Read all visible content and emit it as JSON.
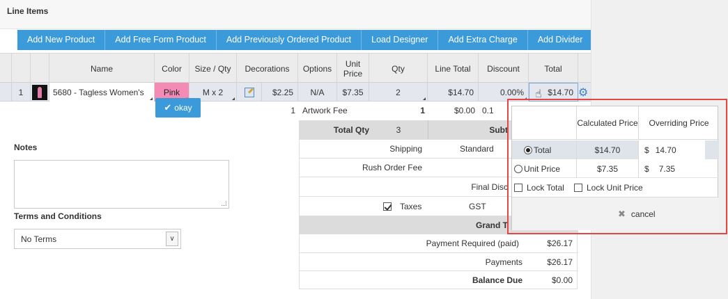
{
  "section_title": "Line Items",
  "toolbar": {
    "buttons": [
      "Add New Product",
      "Add Free Form Product",
      "Add Previously Ordered Product",
      "Load Designer",
      "Add Extra Charge",
      "Add Divider"
    ]
  },
  "table": {
    "headers": {
      "name": "Name",
      "color": "Color",
      "size_qty": "Size / Qty",
      "decorations": "Decorations",
      "options": "Options",
      "unit_price": "Unit Price",
      "qty": "Qty",
      "line_total": "Line Total",
      "discount": "Discount",
      "total": "Total"
    },
    "row1": {
      "index": "1",
      "name": "5680 - Tagless Women's",
      "color": "Pink",
      "size_qty": "M x 2",
      "decorations": "$2.25",
      "options": "N/A",
      "unit_price": "$7.35",
      "qty": "2",
      "line_total": "$14.70",
      "discount": "0.00%",
      "total": "$14.70"
    },
    "row2": {
      "index": "1",
      "name": "Artwork Fee",
      "qty": "1",
      "line_total": "$0.00",
      "discount": "0.1"
    }
  },
  "summary": {
    "total_qty_label": "Total Qty",
    "total_qty_value": "3",
    "subtotal_label": "Subt",
    "shipping_label": "Shipping",
    "shipping_method": "Standard",
    "rush_label": "Rush Order Fee",
    "final_disc_label": "Final Disc",
    "taxes_label": "Taxes",
    "taxes_code": "GST",
    "grand_total_label": "Grand T",
    "payment_required_label": "Payment Required (paid)",
    "payment_required_value": "$26.17",
    "payments_label": "Payments",
    "payments_value": "$26.17",
    "balance_label": "Balance Due",
    "balance_value": "$0.00"
  },
  "notes": {
    "label": "Notes",
    "value": ""
  },
  "terms": {
    "label": "Terms and Conditions",
    "selected": "No Terms"
  },
  "popup": {
    "col_calculated": "Calculated Price",
    "col_overriding": "Overriding Price",
    "rows": [
      {
        "label": "Total",
        "calculated": "$14.70",
        "currency": "$",
        "override": "14.70"
      },
      {
        "label": "Unit Price",
        "calculated": "$7.35",
        "currency": "$",
        "override": "7.35"
      }
    ],
    "lock_total": "Lock Total",
    "lock_unit_price": "Lock Unit Price",
    "cancel": "cancel",
    "okay": "okay"
  },
  "colors": {
    "accent": "#3b9ad9",
    "highlight": "#e54545",
    "pink": "#f38bb5"
  }
}
